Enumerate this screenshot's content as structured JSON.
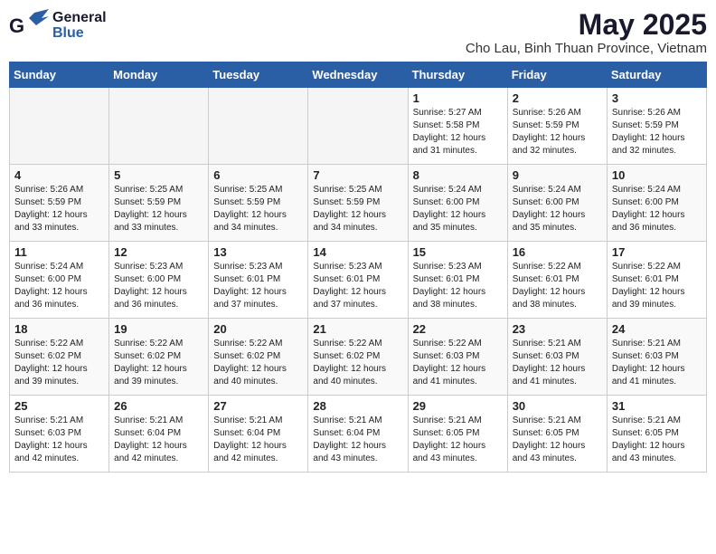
{
  "header": {
    "logo_general": "General",
    "logo_blue": "Blue",
    "month_title": "May 2025",
    "location": "Cho Lau, Binh Thuan Province, Vietnam"
  },
  "weekdays": [
    "Sunday",
    "Monday",
    "Tuesday",
    "Wednesday",
    "Thursday",
    "Friday",
    "Saturday"
  ],
  "weeks": [
    [
      {
        "day": "",
        "info": ""
      },
      {
        "day": "",
        "info": ""
      },
      {
        "day": "",
        "info": ""
      },
      {
        "day": "",
        "info": ""
      },
      {
        "day": "1",
        "info": "Sunrise: 5:27 AM\nSunset: 5:58 PM\nDaylight: 12 hours\nand 31 minutes."
      },
      {
        "day": "2",
        "info": "Sunrise: 5:26 AM\nSunset: 5:59 PM\nDaylight: 12 hours\nand 32 minutes."
      },
      {
        "day": "3",
        "info": "Sunrise: 5:26 AM\nSunset: 5:59 PM\nDaylight: 12 hours\nand 32 minutes."
      }
    ],
    [
      {
        "day": "4",
        "info": "Sunrise: 5:26 AM\nSunset: 5:59 PM\nDaylight: 12 hours\nand 33 minutes."
      },
      {
        "day": "5",
        "info": "Sunrise: 5:25 AM\nSunset: 5:59 PM\nDaylight: 12 hours\nand 33 minutes."
      },
      {
        "day": "6",
        "info": "Sunrise: 5:25 AM\nSunset: 5:59 PM\nDaylight: 12 hours\nand 34 minutes."
      },
      {
        "day": "7",
        "info": "Sunrise: 5:25 AM\nSunset: 5:59 PM\nDaylight: 12 hours\nand 34 minutes."
      },
      {
        "day": "8",
        "info": "Sunrise: 5:24 AM\nSunset: 6:00 PM\nDaylight: 12 hours\nand 35 minutes."
      },
      {
        "day": "9",
        "info": "Sunrise: 5:24 AM\nSunset: 6:00 PM\nDaylight: 12 hours\nand 35 minutes."
      },
      {
        "day": "10",
        "info": "Sunrise: 5:24 AM\nSunset: 6:00 PM\nDaylight: 12 hours\nand 36 minutes."
      }
    ],
    [
      {
        "day": "11",
        "info": "Sunrise: 5:24 AM\nSunset: 6:00 PM\nDaylight: 12 hours\nand 36 minutes."
      },
      {
        "day": "12",
        "info": "Sunrise: 5:23 AM\nSunset: 6:00 PM\nDaylight: 12 hours\nand 36 minutes."
      },
      {
        "day": "13",
        "info": "Sunrise: 5:23 AM\nSunset: 6:01 PM\nDaylight: 12 hours\nand 37 minutes."
      },
      {
        "day": "14",
        "info": "Sunrise: 5:23 AM\nSunset: 6:01 PM\nDaylight: 12 hours\nand 37 minutes."
      },
      {
        "day": "15",
        "info": "Sunrise: 5:23 AM\nSunset: 6:01 PM\nDaylight: 12 hours\nand 38 minutes."
      },
      {
        "day": "16",
        "info": "Sunrise: 5:22 AM\nSunset: 6:01 PM\nDaylight: 12 hours\nand 38 minutes."
      },
      {
        "day": "17",
        "info": "Sunrise: 5:22 AM\nSunset: 6:01 PM\nDaylight: 12 hours\nand 39 minutes."
      }
    ],
    [
      {
        "day": "18",
        "info": "Sunrise: 5:22 AM\nSunset: 6:02 PM\nDaylight: 12 hours\nand 39 minutes."
      },
      {
        "day": "19",
        "info": "Sunrise: 5:22 AM\nSunset: 6:02 PM\nDaylight: 12 hours\nand 39 minutes."
      },
      {
        "day": "20",
        "info": "Sunrise: 5:22 AM\nSunset: 6:02 PM\nDaylight: 12 hours\nand 40 minutes."
      },
      {
        "day": "21",
        "info": "Sunrise: 5:22 AM\nSunset: 6:02 PM\nDaylight: 12 hours\nand 40 minutes."
      },
      {
        "day": "22",
        "info": "Sunrise: 5:22 AM\nSunset: 6:03 PM\nDaylight: 12 hours\nand 41 minutes."
      },
      {
        "day": "23",
        "info": "Sunrise: 5:21 AM\nSunset: 6:03 PM\nDaylight: 12 hours\nand 41 minutes."
      },
      {
        "day": "24",
        "info": "Sunrise: 5:21 AM\nSunset: 6:03 PM\nDaylight: 12 hours\nand 41 minutes."
      }
    ],
    [
      {
        "day": "25",
        "info": "Sunrise: 5:21 AM\nSunset: 6:03 PM\nDaylight: 12 hours\nand 42 minutes."
      },
      {
        "day": "26",
        "info": "Sunrise: 5:21 AM\nSunset: 6:04 PM\nDaylight: 12 hours\nand 42 minutes."
      },
      {
        "day": "27",
        "info": "Sunrise: 5:21 AM\nSunset: 6:04 PM\nDaylight: 12 hours\nand 42 minutes."
      },
      {
        "day": "28",
        "info": "Sunrise: 5:21 AM\nSunset: 6:04 PM\nDaylight: 12 hours\nand 43 minutes."
      },
      {
        "day": "29",
        "info": "Sunrise: 5:21 AM\nSunset: 6:05 PM\nDaylight: 12 hours\nand 43 minutes."
      },
      {
        "day": "30",
        "info": "Sunrise: 5:21 AM\nSunset: 6:05 PM\nDaylight: 12 hours\nand 43 minutes."
      },
      {
        "day": "31",
        "info": "Sunrise: 5:21 AM\nSunset: 6:05 PM\nDaylight: 12 hours\nand 43 minutes."
      }
    ]
  ]
}
